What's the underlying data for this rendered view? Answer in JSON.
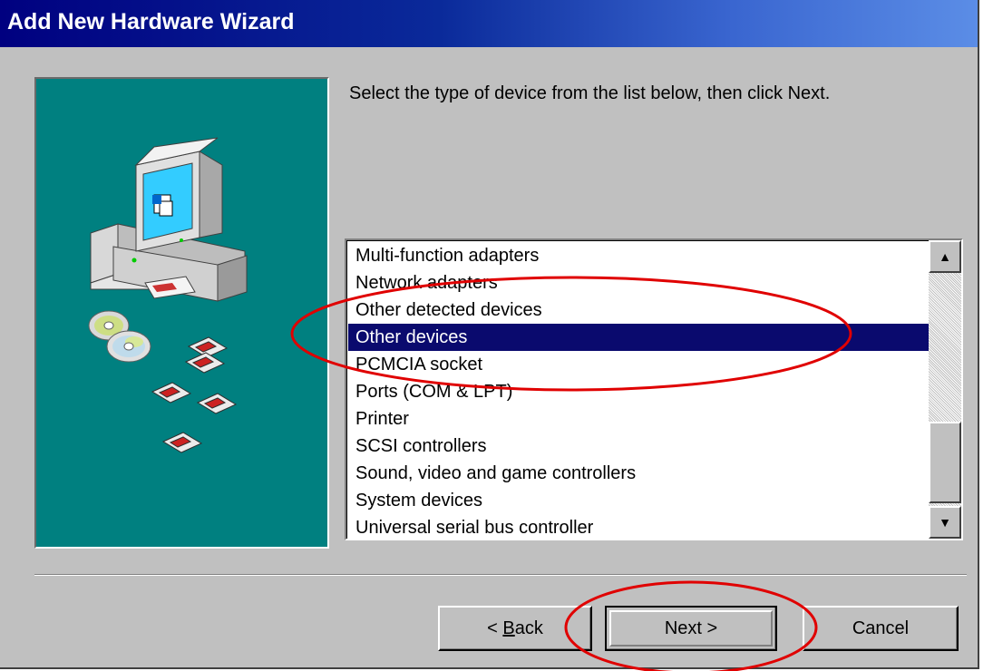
{
  "window": {
    "title": "Add New Hardware Wizard"
  },
  "instruction": "Select the type of device from the list below, then click Next.",
  "device_list": {
    "items": [
      "Multi-function adapters",
      "Network adapters",
      "Other detected devices",
      "Other devices",
      "PCMCIA socket",
      "Ports (COM & LPT)",
      "Printer",
      "SCSI controllers",
      "Sound, video and game controllers",
      "System devices",
      "Universal serial bus controller"
    ],
    "selected": "Other devices"
  },
  "buttons": {
    "back_prefix": "< ",
    "back_underlined": "B",
    "back_rest": "ack",
    "next": "Next >",
    "cancel": "Cancel"
  },
  "colors": {
    "illustration_bg": "#008080",
    "selection_bg": "#0a0a6e",
    "annotation": "#e00000"
  },
  "icons": {
    "illustration": "computer-with-discs-illustration",
    "scroll_up": "scroll-up-arrow-icon",
    "scroll_down": "scroll-down-arrow-icon"
  }
}
